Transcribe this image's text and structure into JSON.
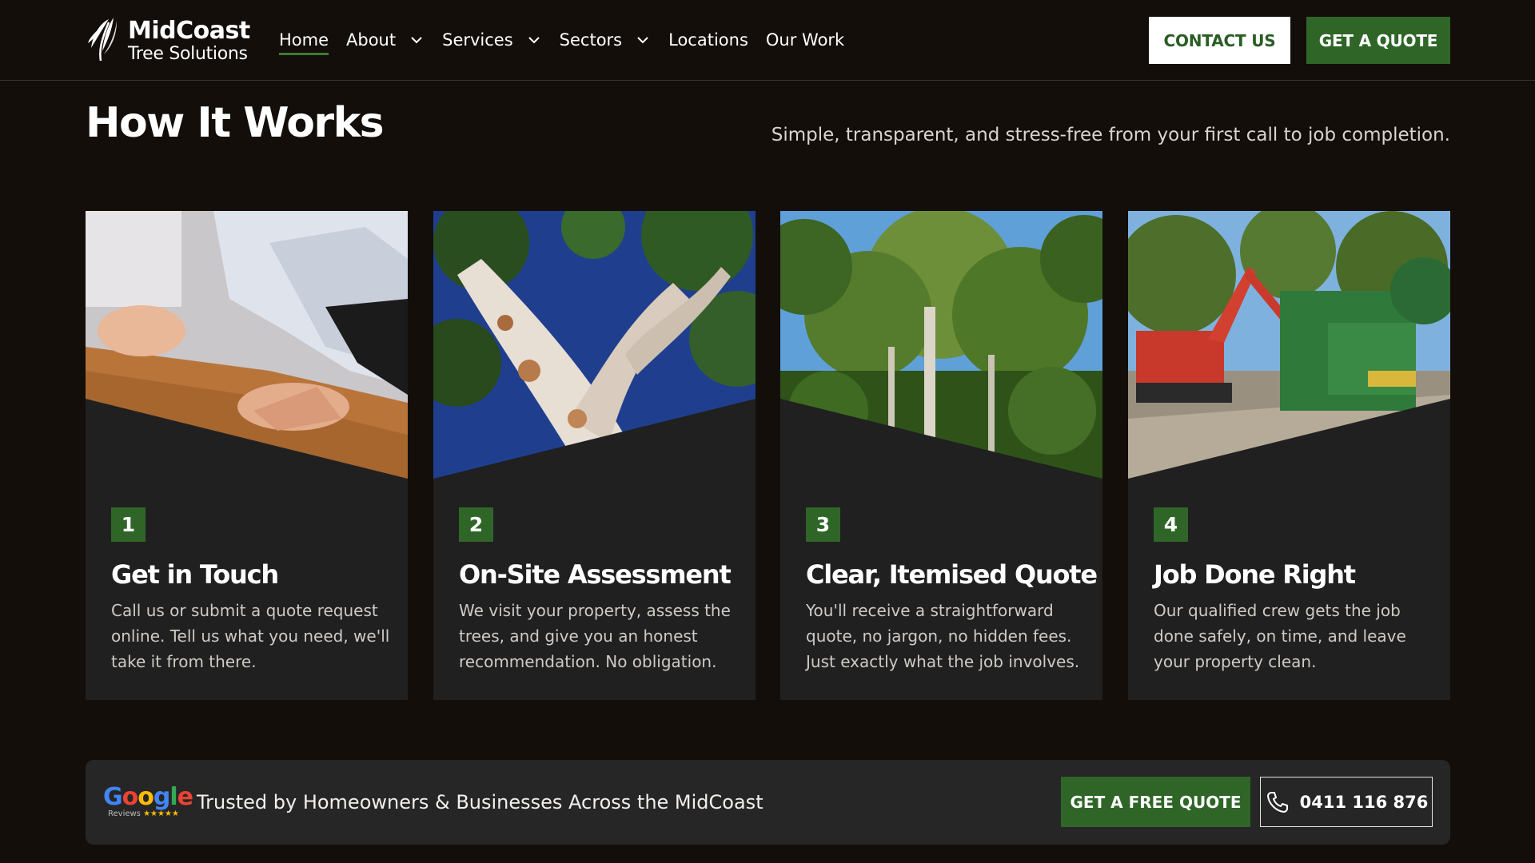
{
  "header": {
    "brand_name": "MidCoast",
    "brand_sub": "Tree Solutions",
    "nav": [
      {
        "label": "Home",
        "active": true,
        "dropdown": false
      },
      {
        "label": "About",
        "active": false,
        "dropdown": true
      },
      {
        "label": "Services",
        "active": false,
        "dropdown": true
      },
      {
        "label": "Sectors",
        "active": false,
        "dropdown": true
      },
      {
        "label": "Locations",
        "active": false,
        "dropdown": false
      },
      {
        "label": "Our Work",
        "active": false,
        "dropdown": false
      }
    ],
    "contact_label": "CONTACT US",
    "quote_label": "GET A QUOTE"
  },
  "section": {
    "title": "How It Works",
    "subtitle": "Simple, transparent, and stress-free from your first call to job completion."
  },
  "steps": [
    {
      "number": "1",
      "title": "Get in Touch",
      "text": "Call us or submit a quote request online. Tell us what you need, we'll take it from there.",
      "photo": "hands-typing-laptop"
    },
    {
      "number": "2",
      "title": "On-Site Assessment",
      "text": "We visit your property, assess the trees, and give you an honest recommendation. No obligation.",
      "photo": "eucalyptus-canopy"
    },
    {
      "number": "3",
      "title": "Clear, Itemised Quote",
      "text": "You'll receive a straightforward quote, no jargon, no hidden fees. Just exactly what the job involves.",
      "photo": "forest-tall-trees"
    },
    {
      "number": "4",
      "title": "Job Done Right",
      "text": "Our qualified crew gets the job done safely, on time, and leave your property clean.",
      "photo": "excavator-and-woodchipper"
    }
  ],
  "trust": {
    "google_word": "Google",
    "google_meta": "Reviews",
    "google_stars": "★★★★★",
    "text": "Trusted by Homeowners & Businesses Across the MidCoast",
    "free_quote_label": "GET A FREE QUOTE",
    "phone": "0411 116 876"
  },
  "colors": {
    "background": "#130e0a",
    "card": "#202020",
    "accent_green": "#2f6628",
    "trust_bar": "#262626"
  }
}
